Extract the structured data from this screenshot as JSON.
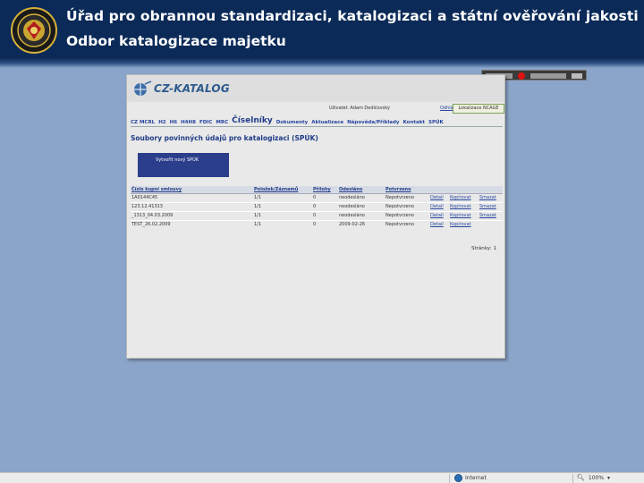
{
  "header": {
    "title_line1": "Úřad pro obrannou standardizaci, katalogizaci a státní ověřování jakosti",
    "title_line2": "Odbor katalogizace majetku",
    "logo_icon": "agency-emblem-icon"
  },
  "catalog_page": {
    "app_name": "CZ-KATALOG",
    "user_text": "Uživatel: Adam Dedičovský",
    "logout_label": "Odhlásit",
    "catalog_button_label": "Lokalizace NCAGE",
    "nav_items": [
      "CZ MCRL",
      "H2",
      "H6",
      "H4H8",
      "FDIC",
      "MRC",
      "Číselníky",
      "Dokumenty",
      "Aktualizace",
      "Nápověda/Příklady",
      "Kontakt",
      "SPÚK"
    ],
    "page_heading": "Soubory povinných údajů pro katalogizaci (SPÚK)",
    "create_button_label": "Vytvořit nový SPÚK",
    "table": {
      "headers": [
        "Číslo kupní smlouvy",
        "Položek/Záznamů",
        "Přílohy",
        "Odesláno",
        "Potvrzeno",
        "",
        "",
        ""
      ],
      "rows": [
        [
          "1A0144C45",
          "1/1",
          "0",
          "neodesláno",
          "Nepotvrzeno",
          "Detail",
          "Kopírovat",
          "Smazat"
        ],
        [
          "123.12.41313",
          "1/1",
          "0",
          "neodesláno",
          "Nepotvrzeno",
          "Detail",
          "Kopírovat",
          "Smazat"
        ],
        [
          "_1313_04.03.2009",
          "1/1",
          "0",
          "neodesláno",
          "Nepotvrzeno",
          "Detail",
          "Kopírovat",
          "Smazat"
        ],
        [
          "TEST_26.02.2009",
          "1/1",
          "0",
          "2009-02-26",
          "Nepotvrzeno",
          "Detail",
          "Kopírovat",
          ""
        ]
      ]
    },
    "pager_label": "Stránky:",
    "pager_page": "1"
  },
  "statusbar": {
    "zone_label": "Internet",
    "zoom_label": "100%"
  },
  "colors": {
    "header_bg": "#0b2a58",
    "slide_bg": "#8aa5c9",
    "link": "#2646a0",
    "create_button": "#2b3e8b"
  }
}
